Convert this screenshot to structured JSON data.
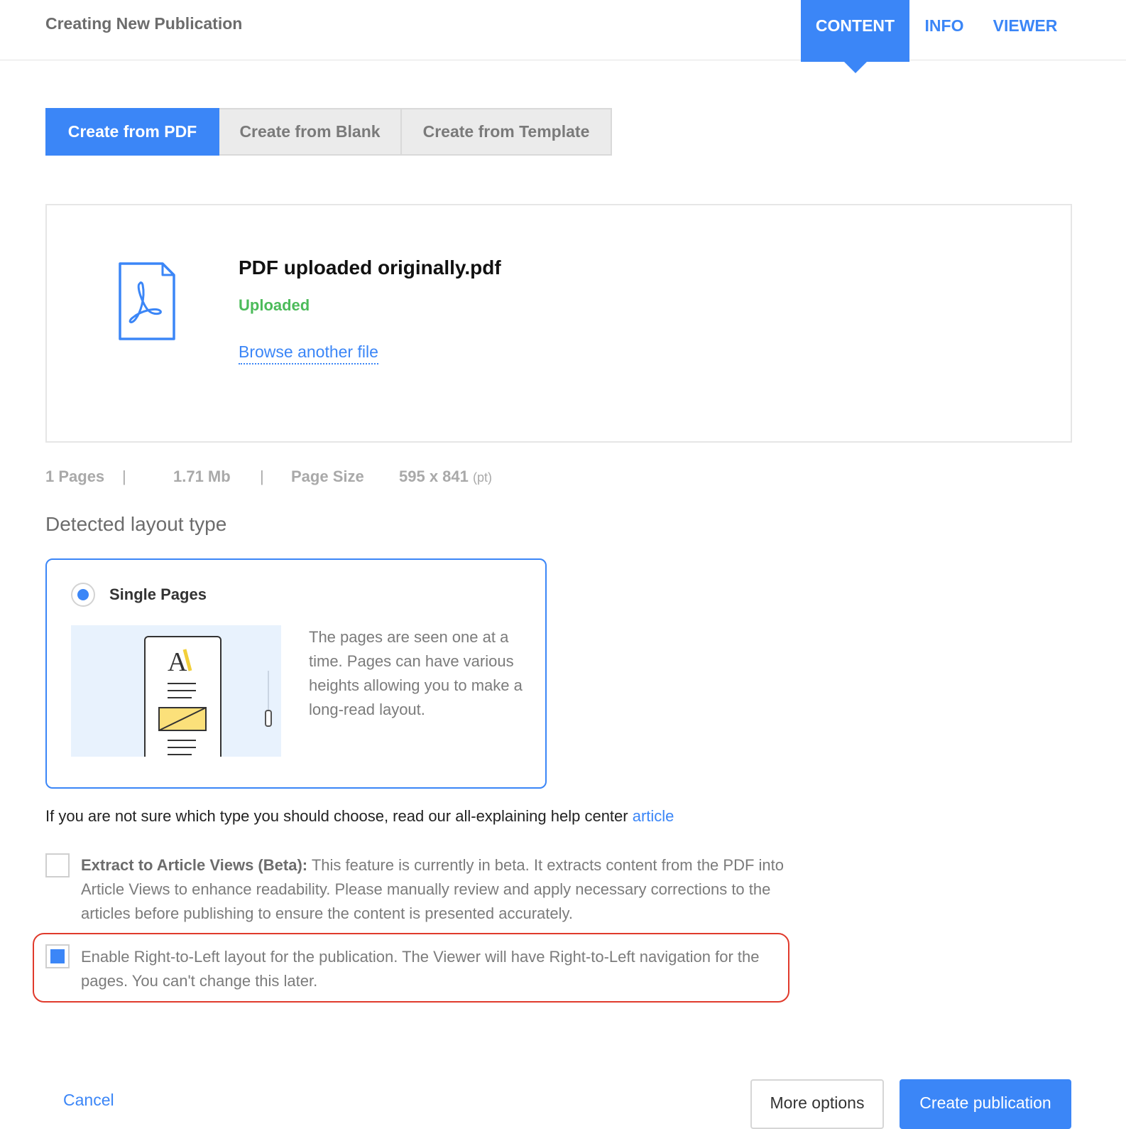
{
  "header": {
    "title": "Creating New Publication",
    "tabs": [
      {
        "label": "CONTENT",
        "active": true
      },
      {
        "label": "INFO",
        "active": false
      },
      {
        "label": "VIEWER",
        "active": false
      }
    ]
  },
  "source_tabs": [
    {
      "label": "Create from PDF",
      "active": true
    },
    {
      "label": "Create from Blank",
      "active": false
    },
    {
      "label": "Create from Template",
      "active": false
    }
  ],
  "upload": {
    "icon": "pdf-file-icon",
    "file_name": "PDF uploaded originally.pdf",
    "status": "Uploaded",
    "browse_label": "Browse another file"
  },
  "file_meta": {
    "pages": "1 Pages",
    "separator": "|",
    "size": "1.71 Mb",
    "page_size_label": "Page Size",
    "page_size_value": "595 x 841",
    "page_size_unit": "(pt)"
  },
  "layout": {
    "section_title": "Detected layout type",
    "option_label": "Single Pages",
    "selected": true,
    "description": "The pages are seen one at a time. Pages can have various heights allowing you to make a long-read layout."
  },
  "help": {
    "text": "If you are not sure which type you should choose, read our all-explaining help center ",
    "link": "article"
  },
  "options": {
    "extract": {
      "checked": false,
      "title": "Extract to Article Views (Beta):",
      "text": " This feature is currently in beta. It extracts content from the PDF into Article Views to enhance readability. Please manually review and apply necessary corrections to the articles before publishing to ensure the content is presented accurately."
    },
    "rtl": {
      "checked": true,
      "text": "Enable Right-to-Left layout for the publication. The Viewer will have Right-to-Left navigation for the pages. You can't change this later."
    }
  },
  "footer": {
    "cancel_label": "Cancel",
    "more_options_label": "More options",
    "create_label": "Create publication"
  },
  "colors": {
    "accent": "#3b86f7",
    "success": "#4cbb5a",
    "highlight": "#e03a2c"
  }
}
